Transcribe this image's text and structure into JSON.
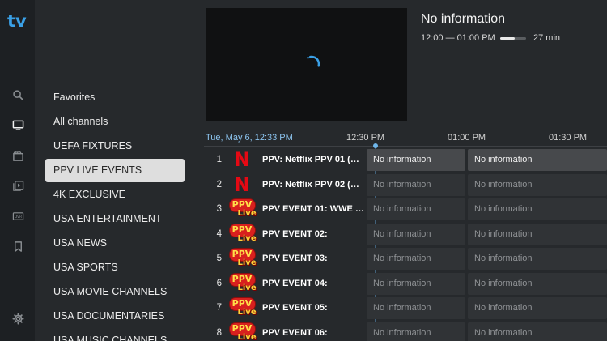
{
  "app": {
    "logo_text": "tv"
  },
  "rail": {
    "items": [
      {
        "icon": "search-icon"
      },
      {
        "icon": "tv-icon"
      },
      {
        "icon": "movie-icon"
      },
      {
        "icon": "video-library-icon"
      },
      {
        "icon": "dvr-icon"
      },
      {
        "icon": "bookmark-icon"
      },
      {
        "icon": "settings-icon"
      }
    ]
  },
  "categories": [
    {
      "label": "Favorites"
    },
    {
      "label": "All channels"
    },
    {
      "label": "UEFA FIXTURES"
    },
    {
      "label": "PPV LIVE EVENTS"
    },
    {
      "label": "4K EXCLUSIVE"
    },
    {
      "label": "USA ENTERTAINMENT"
    },
    {
      "label": "USA NEWS"
    },
    {
      "label": "USA SPORTS"
    },
    {
      "label": "USA MOVIE CHANNELS"
    },
    {
      "label": "USA DOCUMENTARIES"
    },
    {
      "label": "USA MUSIC CHANNELS"
    }
  ],
  "selected_category": "PPV LIVE EVENTS",
  "now_playing": {
    "title": "No information",
    "time_range": "12:00 — 01:00 PM",
    "progress": 0.55,
    "remaining": "27 min"
  },
  "timeline": {
    "date_time": "Tue, May 6, 12:33 PM",
    "ticks": [
      "12:30 PM",
      "01:00 PM",
      "01:30 PM"
    ]
  },
  "channels": [
    {
      "number": "1",
      "logo": "netflix-logo",
      "logo_text": "N",
      "name": "PPV: Netflix PPV 01 (Ev...",
      "programs": [
        "No information",
        "No information"
      ]
    },
    {
      "number": "2",
      "logo": "netflix-logo",
      "logo_text": "N",
      "name": "PPV: Netflix PPV 02 (Ev...",
      "programs": [
        "No information",
        "No information"
      ]
    },
    {
      "number": "3",
      "logo": "ppv-live-logo",
      "logo_text": "PPV",
      "logo_sub": "Live",
      "name": "PPV EVENT 01: WWE M...",
      "programs": [
        "No information",
        "No information"
      ]
    },
    {
      "number": "4",
      "logo": "ppv-live-logo",
      "logo_text": "PPV",
      "logo_sub": "Live",
      "name": "PPV EVENT 02:",
      "programs": [
        "No information",
        "No information"
      ]
    },
    {
      "number": "5",
      "logo": "ppv-live-logo",
      "logo_text": "PPV",
      "logo_sub": "Live",
      "name": "PPV EVENT 03:",
      "programs": [
        "No information",
        "No information"
      ]
    },
    {
      "number": "6",
      "logo": "ppv-live-logo",
      "logo_text": "PPV",
      "logo_sub": "Live",
      "name": "PPV EVENT 04:",
      "programs": [
        "No information",
        "No information"
      ]
    },
    {
      "number": "7",
      "logo": "ppv-live-logo",
      "logo_text": "PPV",
      "logo_sub": "Live",
      "name": "PPV EVENT 05:",
      "programs": [
        "No information",
        "No information"
      ]
    },
    {
      "number": "8",
      "logo": "ppv-live-logo",
      "logo_text": "PPV",
      "logo_sub": "Live",
      "name": "PPV EVENT 06:",
      "programs": [
        "No information",
        "No information"
      ]
    }
  ],
  "selected_channel": "1",
  "colors": {
    "accent": "#3aa0e6",
    "background": "#26292c",
    "rail": "#1d2023",
    "netflix_red": "#e50914",
    "ppv_red": "#d8201e",
    "ppv_yellow": "#ffe04a"
  }
}
